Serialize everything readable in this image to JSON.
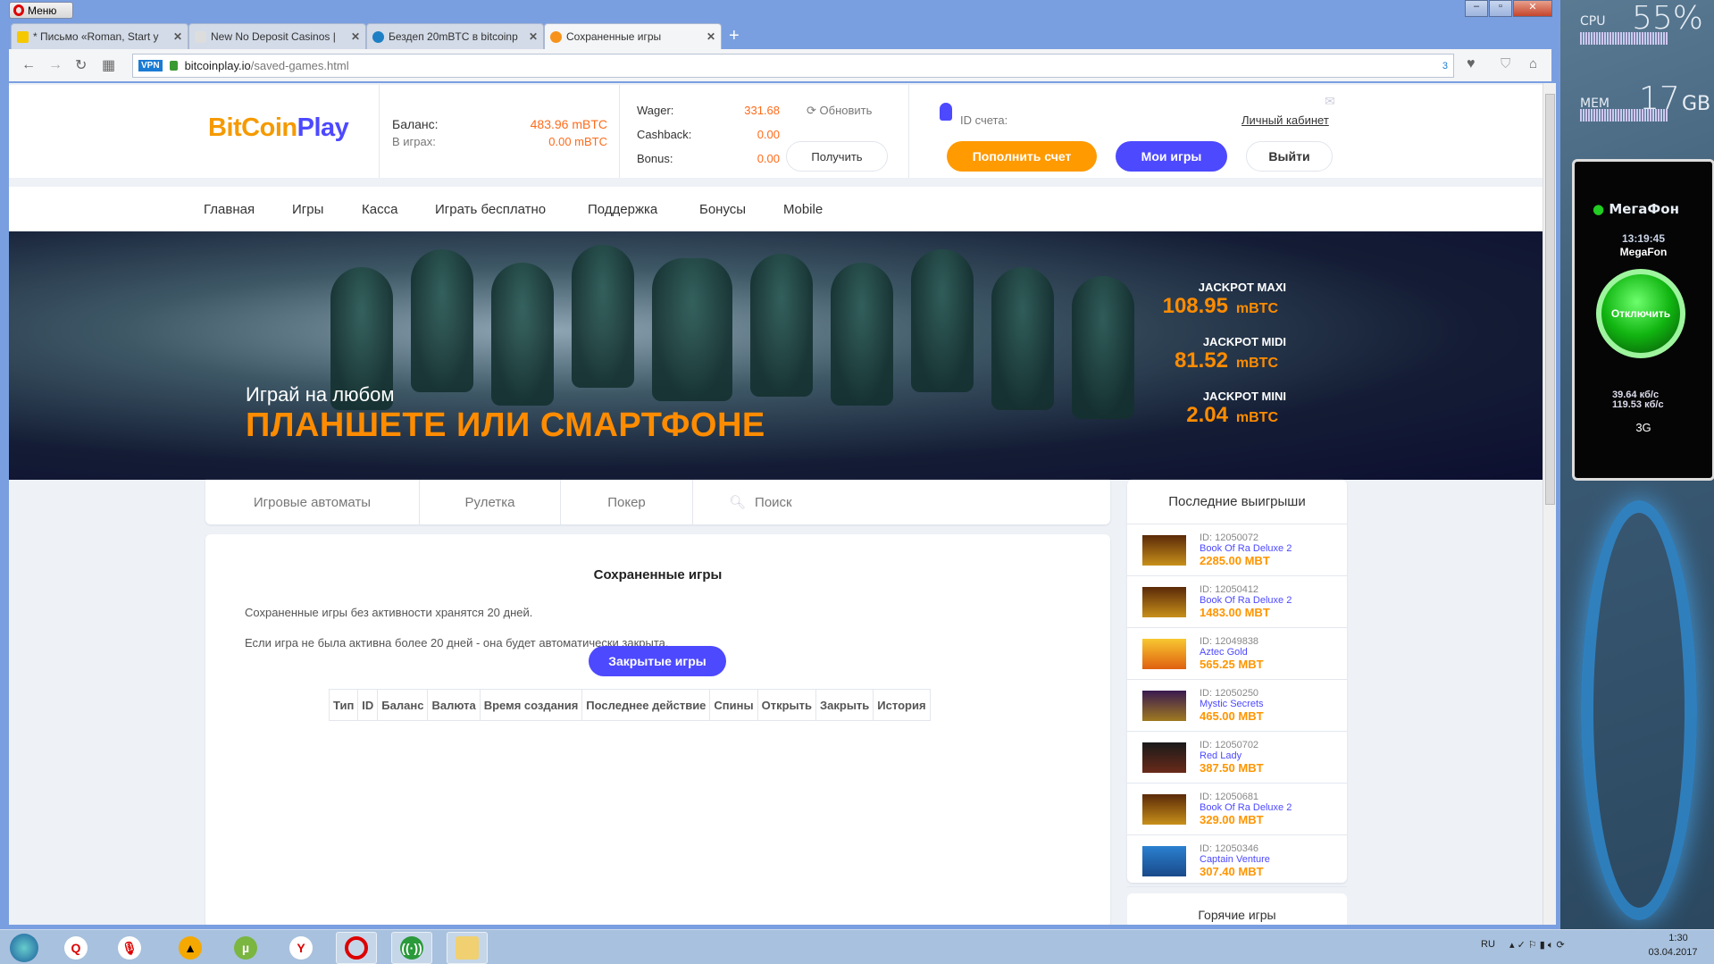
{
  "browser": {
    "menu_label": "Меню",
    "tabs": [
      {
        "title": "* Письмо «Roman, Start y",
        "icon": "yandex-mail-icon"
      },
      {
        "title": "New No Deposit Casinos |",
        "icon": "spade-icon"
      },
      {
        "title": "Бездеп 20mBTC в bitcoinp",
        "icon": "kf-icon"
      },
      {
        "title": "Сохраненные игры",
        "icon": "bitcoin-icon",
        "active": true
      }
    ],
    "url_host": "bitcoinplay.io",
    "url_path": "/saved-games.html",
    "vpn": "VPN",
    "badge_count": "3"
  },
  "header": {
    "logo_a": "Bit",
    "logo_b": "Coin",
    "logo_c": "Play",
    "balance_label": "Баланс:",
    "balance_value": "483.96 mBTC",
    "ingame_label": "В играх:",
    "ingame_value": "0.00 mBTC",
    "wager_label": "Wager:",
    "wager_value": "331.68",
    "refresh": "Обновить",
    "cashback_label": "Cashback:",
    "cashback_value": "0.00",
    "bonus_label": "Bonus:",
    "bonus_value": "0.00",
    "get_button": "Получить",
    "account_id_label": "ID счета:",
    "cabinet_link": "Личный кабинет",
    "deposit_button": "Пополнить счет",
    "my_games_button": "Мои игры",
    "logout_button": "Выйти"
  },
  "nav": [
    "Главная",
    "Игры",
    "Касса",
    "Играть бесплатно",
    "Поддержка",
    "Бонусы",
    "Mobile"
  ],
  "banner": {
    "line1": "Играй на любом",
    "line2": "ПЛАНШЕТЕ ИЛИ СМАРТФОНЕ",
    "jackpots": [
      {
        "label": "JACKPOT MAXI",
        "value": "108.95",
        "unit": "mBTC"
      },
      {
        "label": "JACKPOT MIDI",
        "value": "81.52",
        "unit": "mBTC"
      },
      {
        "label": "JACKPOT MINI",
        "value": "2.04",
        "unit": "mBTC"
      }
    ]
  },
  "categories": [
    "Игровые автоматы",
    "Рулетка",
    "Покер"
  ],
  "search_placeholder": "Поиск",
  "content": {
    "title": "Сохраненные игры",
    "text1": "Сохраненные игры без активности хранятся 20 дней.",
    "text2": "Если игра не была активна более 20 дней - она будет автоматически закрыта.",
    "closed_button": "Закрытые игры",
    "columns": [
      "Тип",
      "ID",
      "Баланс",
      "Валюта",
      "Время создания",
      "Последнее действие",
      "Спины",
      "Открыть",
      "Закрыть",
      "История"
    ]
  },
  "sidebar": {
    "title": "Последние выигрыши",
    "wins": [
      {
        "id": "ID: 12050072",
        "game": "Book Of Ra Deluxe 2",
        "amount": "2285.00 MBT"
      },
      {
        "id": "ID: 12050412",
        "game": "Book Of Ra Deluxe 2",
        "amount": "1483.00 MBT"
      },
      {
        "id": "ID: 12049838",
        "game": "Aztec Gold",
        "amount": "565.25 MBT"
      },
      {
        "id": "ID: 12050250",
        "game": "Mystic Secrets",
        "amount": "465.00 MBT"
      },
      {
        "id": "ID: 12050702",
        "game": "Red Lady",
        "amount": "387.50 MBT"
      },
      {
        "id": "ID: 12050681",
        "game": "Book Of Ra Deluxe 2",
        "amount": "329.00 MBT"
      },
      {
        "id": "ID: 12050346",
        "game": "Captain Venture",
        "amount": "307.40 MBT"
      }
    ],
    "hot_title": "Горячие игры"
  },
  "desktop": {
    "cpu_label": "CPU",
    "cpu_value": "55%",
    "mem_label": "MEM",
    "mem_value": "17",
    "mem_unit": "GB",
    "megafon_brand": "МегаФон",
    "megafon_time": "13:19:45",
    "megafon_operator": "MegaFon",
    "megafon_button": "Отключить",
    "upload": "39.64 кб/с",
    "download": "119.53 кб/с",
    "network": "3G"
  },
  "taskbar": {
    "lang": "RU",
    "time": "1:30",
    "date": "03.04.2017"
  }
}
